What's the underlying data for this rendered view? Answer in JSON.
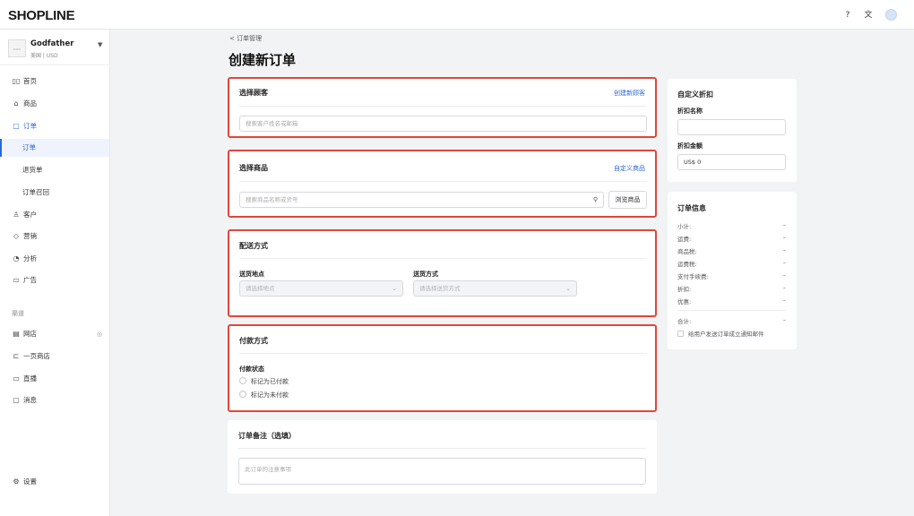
{
  "app": {
    "logo": "SHOPLINE"
  },
  "store": {
    "name": "Godfather",
    "region": "美国 | USD"
  },
  "sidebar": {
    "items": [
      {
        "label": "首页",
        "icon": "▯▯"
      },
      {
        "label": "商品",
        "icon": "⌂"
      },
      {
        "label": "订单",
        "icon": "▢"
      },
      {
        "label": "订单"
      },
      {
        "label": "退货单"
      },
      {
        "label": "订单召回"
      },
      {
        "label": "客户",
        "icon": "♙"
      },
      {
        "label": "营销",
        "icon": "◇"
      },
      {
        "label": "分析",
        "icon": "◔"
      },
      {
        "label": "广告",
        "icon": "▭"
      }
    ],
    "channels_label": "渠道",
    "channels": [
      {
        "label": "网店",
        "icon": "▤"
      },
      {
        "label": "一页商店",
        "icon": "⊏"
      },
      {
        "label": "直播",
        "icon": "▭"
      },
      {
        "label": "消息",
        "icon": "▢"
      }
    ],
    "settings": {
      "label": "设置",
      "icon": "⚙"
    }
  },
  "breadcrumb": "<  订单管理",
  "page_title": "创建新订单",
  "customer": {
    "title": "选择顾客",
    "create_link": "创建新顾客",
    "search_placeholder": "搜索客户姓名或邮箱"
  },
  "products": {
    "title": "选择商品",
    "custom_link": "自定义商品",
    "search_placeholder": "搜索商品名称或货号",
    "browse_button": "浏览商品"
  },
  "shipping": {
    "title": "配送方式",
    "location_label": "送货地点",
    "location_placeholder": "请选择地点",
    "method_label": "送货方式",
    "method_placeholder": "请选择送货方式"
  },
  "payment": {
    "title": "付款方式",
    "status_label": "付款状态",
    "options": [
      "标记为已付款",
      "标记为未付款"
    ]
  },
  "notes": {
    "title": "订单备注（选填）",
    "placeholder": "此订单的注意事项"
  },
  "discount": {
    "title": "自定义折扣",
    "name_label": "折扣名称",
    "name_value": "",
    "amount_label": "折扣金额",
    "amount_value": "US$ 0"
  },
  "order_info": {
    "title": "订单信息",
    "rows": [
      {
        "label": "小计:",
        "value": "–"
      },
      {
        "label": "运费:",
        "value": "–"
      },
      {
        "label": "商品税:",
        "value": "–"
      },
      {
        "label": "运费税:",
        "value": "–"
      },
      {
        "label": "支付手续费:",
        "value": "–"
      },
      {
        "label": "折扣:",
        "value": "–"
      },
      {
        "label": "优惠:",
        "value": "–"
      }
    ],
    "total": {
      "label": "合计:",
      "value": "–"
    },
    "notify_label": "给用户发送订单成立通知邮件"
  },
  "colors": {
    "accent": "#2a66d9",
    "highlight": "#e0473a"
  }
}
